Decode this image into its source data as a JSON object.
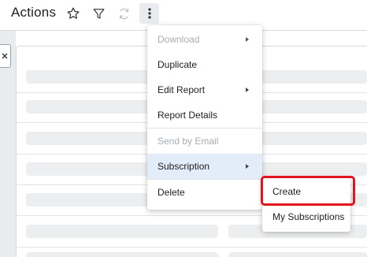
{
  "header": {
    "title": "Actions",
    "icons": [
      "star-icon",
      "filter-icon",
      "refresh-icon",
      "more-vertical-icon"
    ]
  },
  "menu": {
    "items": [
      {
        "label": "Download",
        "disabled": true,
        "has_submenu": true
      },
      {
        "label": "Duplicate",
        "disabled": false,
        "has_submenu": false
      },
      {
        "label": "Edit Report",
        "disabled": false,
        "has_submenu": true
      },
      {
        "label": "Report Details",
        "disabled": false,
        "has_submenu": false
      },
      {
        "label": "Send by Email",
        "disabled": true,
        "has_submenu": false
      },
      {
        "label": "Subscription",
        "disabled": false,
        "has_submenu": true,
        "active": true
      },
      {
        "label": "Delete",
        "disabled": false,
        "has_submenu": false
      }
    ]
  },
  "submenu": {
    "items": [
      {
        "label": "Create",
        "highlighted": true
      },
      {
        "label": "My Subscriptions",
        "highlighted": false
      }
    ]
  },
  "colors": {
    "highlight_border": "#e3141b",
    "active_item_bg": "#e3ecf9",
    "disabled_text": "#a6acb3",
    "skeleton": "#eceef0"
  }
}
